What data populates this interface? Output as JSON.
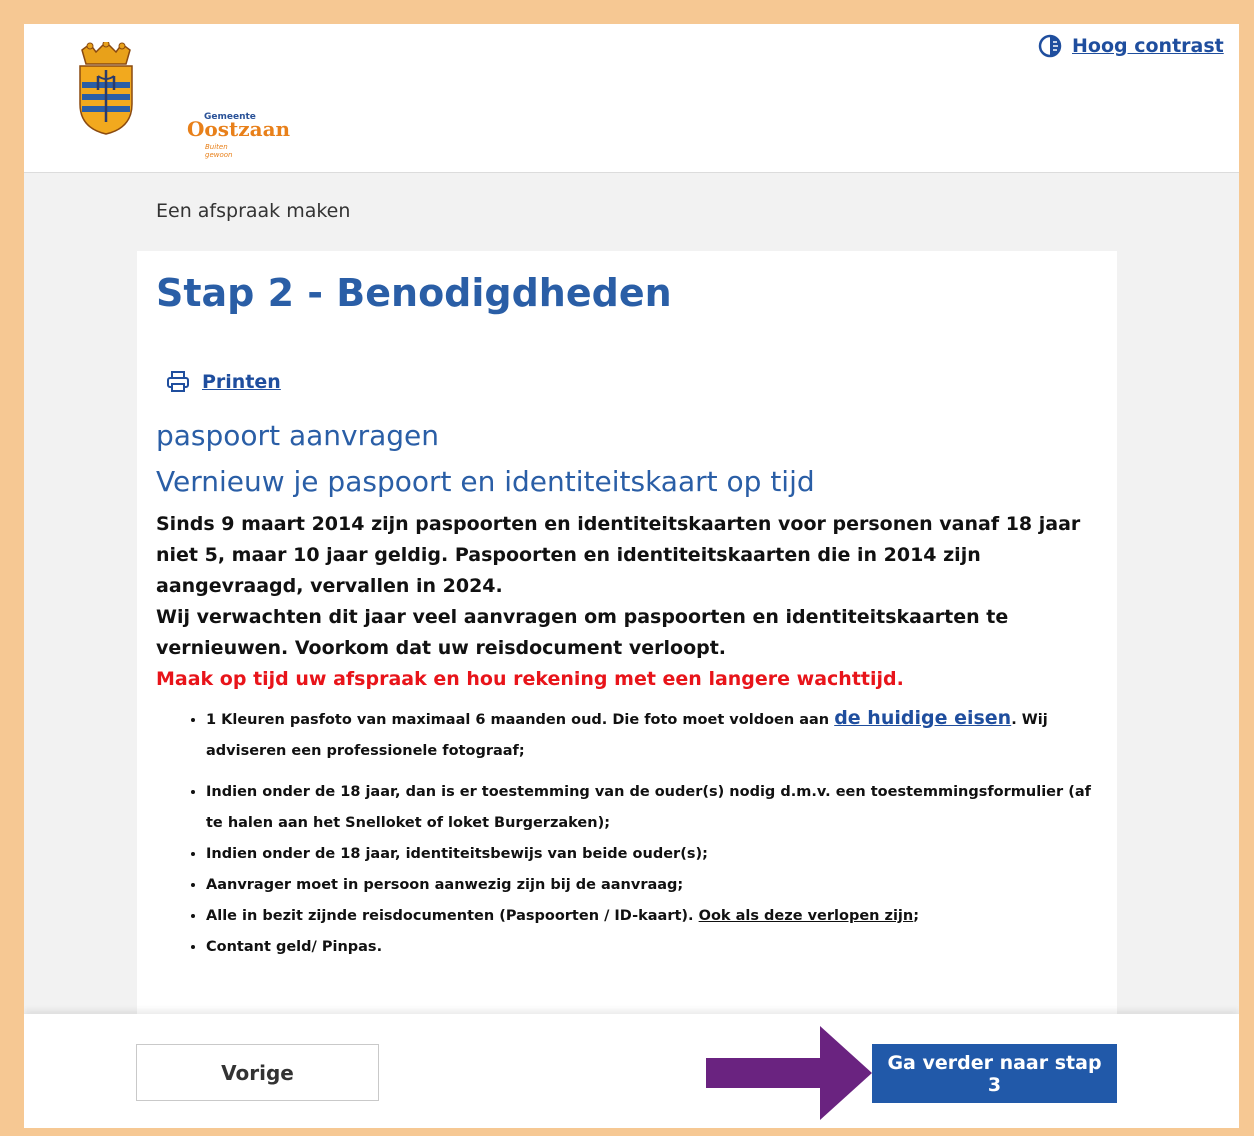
{
  "header": {
    "logo": {
      "line1": "Gemeente",
      "line2": "Oostzaan",
      "line3": "Buiten gewoon"
    },
    "contrast_label": "Hoog contrast"
  },
  "breadcrumb": "Een afspraak maken",
  "main": {
    "title": "Stap 2 - Benodigdheden",
    "print_label": "Printen",
    "subtitle": "paspoort aanvragen",
    "heading": "Vernieuw je paspoort en identiteitskaart op tijd",
    "paragraph1": "Sinds 9 maart 2014 zijn paspoorten en identiteitskaarten voor personen vanaf 18 jaar niet 5, maar 10 jaar geldig. Paspoorten en identiteitskaarten die in 2014 zijn aangevraagd, vervallen in 2024.",
    "paragraph2": "Wij verwachten dit jaar veel aanvragen om paspoorten en identiteitskaarten te vernieuwen. Voorkom dat uw reisdocument verloopt.",
    "warning": "Maak op tijd uw afspraak en hou rekening met een langere wachttijd.",
    "requirements": {
      "item1_pre": "1 Kleuren pasfoto van maximaal 6 maanden oud. Die foto moet voldoen aan ",
      "item1_link": "de huidige eisen",
      "item1_post": ". Wij adviseren een professionele fotograaf;",
      "item2": "Indien onder de 18 jaar, dan is er toestemming van de ouder(s) nodig d.m.v. een toestemmingsformulier (af te halen aan het Snelloket of loket Burgerzaken);",
      "item3": "Indien onder de 18 jaar, identiteitsbewijs van beide ouder(s);",
      "item4": "Aanvrager moet in persoon aanwezig zijn bij de aanvraag;",
      "item5_pre": "Alle in bezit zijnde reisdocumenten (Paspoorten / ID-kaart). ",
      "item5_link": "Ook als deze verlopen zijn",
      "item5_post": ";",
      "item6": "Contant geld/ Pinpas."
    }
  },
  "footer": {
    "prev_label": "Vorige",
    "next_label": "Ga verder naar stap 3"
  },
  "colors": {
    "accent": "#2159a9",
    "heading": "#2a5ea6",
    "warning": "#e8141a",
    "annotation_arrow": "#6a2380",
    "border": "#f6c893"
  }
}
